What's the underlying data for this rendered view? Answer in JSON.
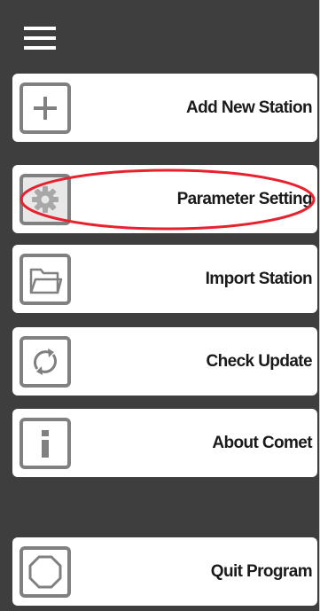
{
  "menu": {
    "items": [
      {
        "label": "Add New Station",
        "icon": "plus-icon"
      },
      {
        "label": "Parameter Setting",
        "icon": "gear-icon"
      },
      {
        "label": "Import Station",
        "icon": "folder-icon"
      },
      {
        "label": "Check Update",
        "icon": "refresh-icon"
      },
      {
        "label": "About Comet",
        "icon": "info-icon"
      }
    ],
    "quit": {
      "label": "Quit Program",
      "icon": "octagon-stop-icon"
    }
  },
  "annotation": {
    "color": "#e8212e",
    "target": "Parameter Setting"
  }
}
